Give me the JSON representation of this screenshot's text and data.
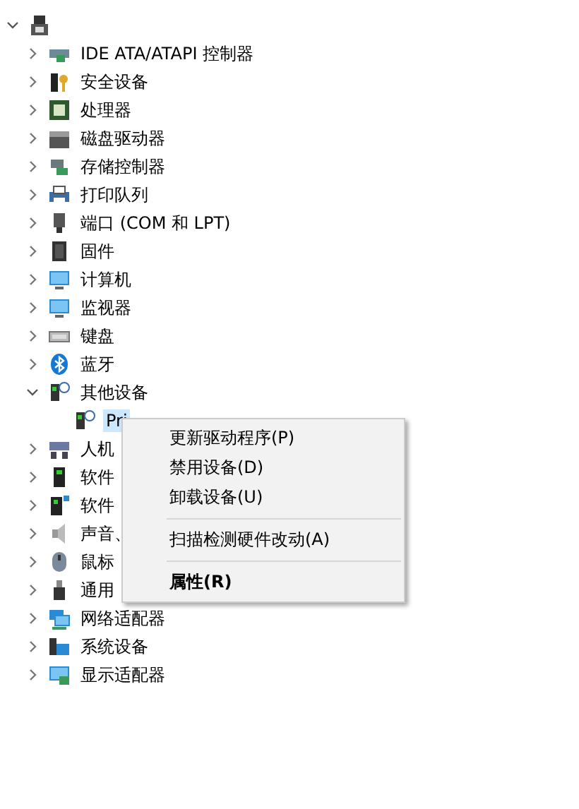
{
  "tree": {
    "expanded": true,
    "children": [
      {
        "label": "IDE ATA/ATAPI 控制器",
        "expanded": false
      },
      {
        "label": "安全设备",
        "expanded": false
      },
      {
        "label": "处理器",
        "expanded": false
      },
      {
        "label": "磁盘驱动器",
        "expanded": false
      },
      {
        "label": "存储控制器",
        "expanded": false
      },
      {
        "label": "打印队列",
        "expanded": false
      },
      {
        "label": "端口 (COM 和 LPT)",
        "expanded": false
      },
      {
        "label": "固件",
        "expanded": false
      },
      {
        "label": "计算机",
        "expanded": false
      },
      {
        "label": "监视器",
        "expanded": false
      },
      {
        "label": "键盘",
        "expanded": false
      },
      {
        "label": "蓝牙",
        "expanded": false
      },
      {
        "label": "其他设备",
        "expanded": true,
        "children": [
          {
            "label": "Pri",
            "selected": true
          }
        ]
      },
      {
        "label": "人机",
        "expanded": false
      },
      {
        "label": "软件",
        "expanded": false
      },
      {
        "label": "软件",
        "expanded": false
      },
      {
        "label": "声音、",
        "expanded": false
      },
      {
        "label": "鼠标",
        "expanded": false
      },
      {
        "label": "通用",
        "expanded": false
      },
      {
        "label": "网络适配器",
        "expanded": false
      },
      {
        "label": "系统设备",
        "expanded": false
      },
      {
        "label": "显示适配器",
        "expanded": false
      }
    ]
  },
  "context_menu": {
    "items": [
      {
        "kind": "item",
        "label": "更新驱动程序(P)"
      },
      {
        "kind": "item",
        "label": "禁用设备(D)"
      },
      {
        "kind": "item",
        "label": "卸载设备(U)"
      },
      {
        "kind": "separator"
      },
      {
        "kind": "item",
        "label": "扫描检测硬件改动(A)"
      },
      {
        "kind": "separator"
      },
      {
        "kind": "default",
        "label": "属性(R)"
      }
    ]
  }
}
